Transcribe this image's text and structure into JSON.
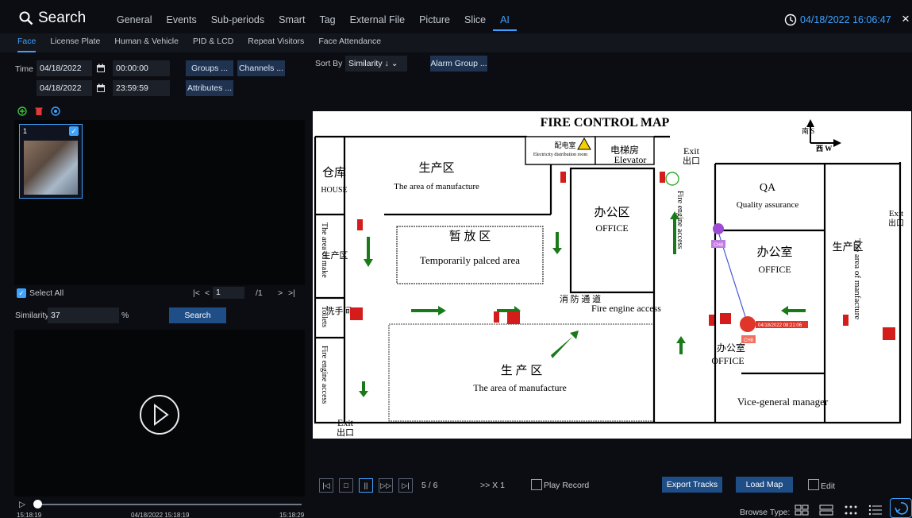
{
  "app": {
    "title": "Search",
    "datetime": "04/18/2022 16:06:47",
    "close": "×"
  },
  "tabs": [
    "General",
    "Events",
    "Sub-periods",
    "Smart",
    "Tag",
    "External File",
    "Picture",
    "Slice",
    "AI"
  ],
  "active_tab": "AI",
  "subtabs": [
    "Face",
    "License Plate",
    "Human & Vehicle",
    "PID & LCD",
    "Repeat Visitors",
    "Face Attendance"
  ],
  "active_subtab": "Face",
  "filters": {
    "time_label": "Time",
    "start_date": "04/18/2022",
    "start_time": "00:00:00",
    "end_date": "04/18/2022",
    "end_time": "23:59:59",
    "groups": "Groups ...",
    "channels": "Channels ...",
    "attributes": "Attributes ..."
  },
  "sort": {
    "label": "Sort By",
    "value": "Similarity ↓",
    "alarm_group": "Alarm Group ..."
  },
  "thumb": {
    "index": "1"
  },
  "pager": {
    "select_all": "Select All",
    "page": "1",
    "total": "/1"
  },
  "similarity": {
    "label": "Similarity",
    "value": "37",
    "unit": "%",
    "search": "Search"
  },
  "timeline": {
    "start": "15:18:19",
    "mid": "04/18/2022 15:18:19",
    "end": "15:18:29"
  },
  "map": {
    "title": "FIRE CONTROL MAP",
    "compass": {
      "s": "南\nS",
      "w": "西 W"
    },
    "elec_cn": "配电室",
    "elec_en": "Electricity distribution room",
    "elev_cn": "电梯房",
    "elev_en": "Elevator",
    "exit_en": "Exit",
    "exit_cn": "出口",
    "house_cn": "仓库",
    "house_en": "HOUSE",
    "manuf_cn": "生产区",
    "manuf_en": "The  area  of  manufacture",
    "temp_cn": "暂 放 区",
    "temp_en": "Temporarily palced area",
    "office_cn": "办公区",
    "office_en": "OFFICE",
    "qa_en": "QA",
    "qa_full": "Quality assurance",
    "office2_cn": "办公室",
    "office2_en": "OFFICE",
    "make_en": "The area of make",
    "make_cn": "生产区",
    "toilets_en": "Toilets",
    "toilets_cn": "洗手间",
    "fire_access": "Fire engine access",
    "fire_access_cn": "消  防  通  道",
    "big_manuf_cn": "生      产      区",
    "big_manuf_en": "The   area   of   manufacture",
    "office3_cn": "办公室",
    "office3_en": "OFFICE",
    "vice_gm": "Vice-general manager",
    "right_manuf_en": "The area of manfacture",
    "right_manuf_cn": "生产区",
    "exit2_en": "Exit",
    "exit2_cn": "出口",
    "exit3_en": "Exit",
    "exit3_cn": "出口",
    "event_time": "04/18/2022 08:21:06",
    "ch_label_1": "CH8",
    "ch_label_2": "CH8"
  },
  "playback": {
    "counter": "5 / 6",
    "speed": ">> X 1",
    "play_record": "Play Record",
    "export": "Export Tracks",
    "load_map": "Load Map",
    "edit": "Edit",
    "browse_type": "Browse Type:"
  }
}
